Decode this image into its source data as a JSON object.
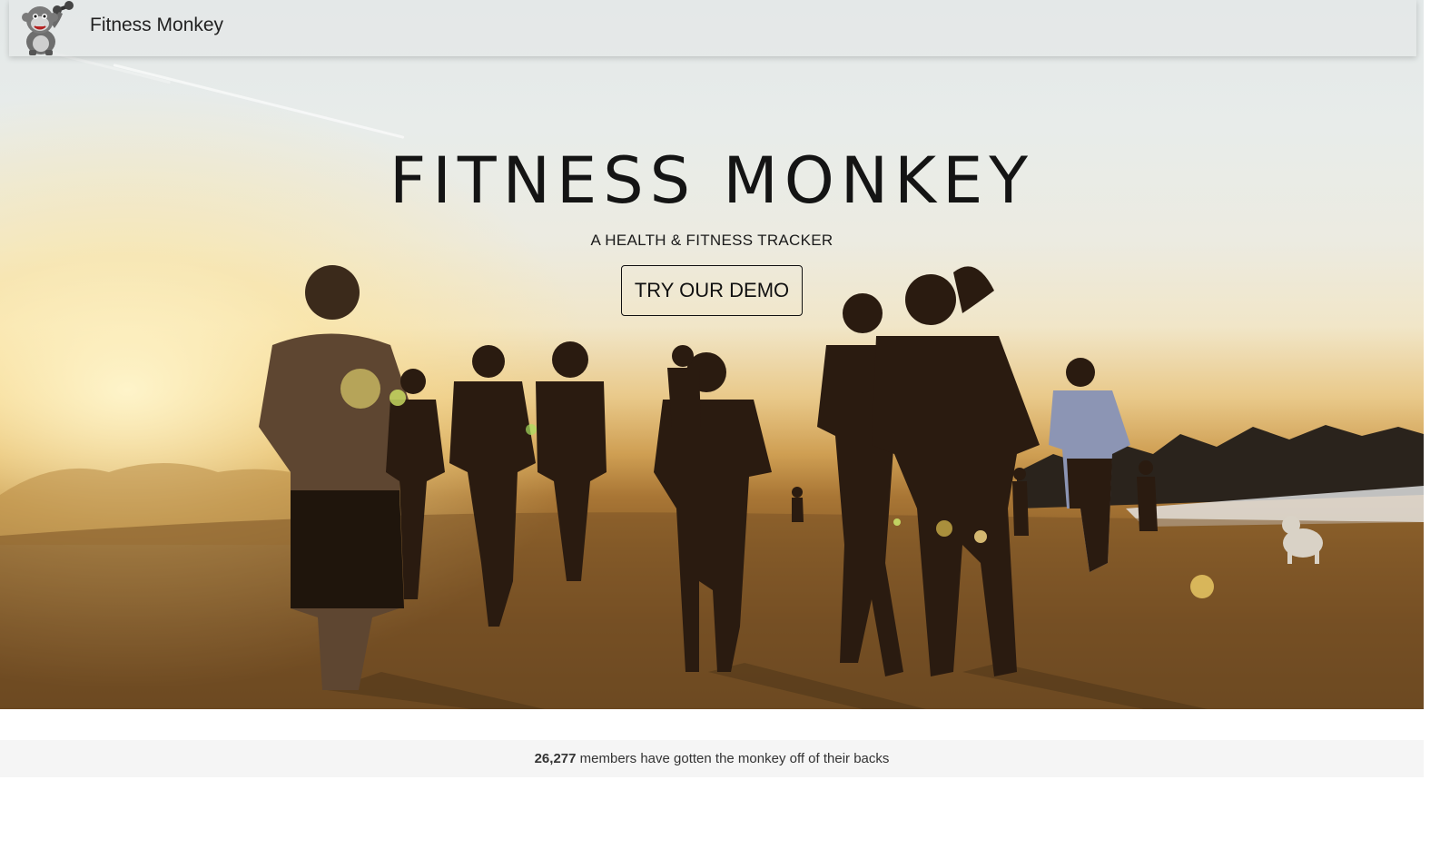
{
  "navbar": {
    "brand_name": "Fitness Monkey",
    "logo_icon": "monkey-lifting-dumbbell-logo"
  },
  "hero": {
    "title": "FITNESS MONKEY",
    "subtitle": "A HEALTH & FITNESS TRACKER",
    "cta_label": "TRY OUR DEMO",
    "background": "runners-on-beach-at-sunset-photo"
  },
  "stats": {
    "member_count": "26,277",
    "member_text": " members have gotten the monkey off of their backs"
  },
  "colors": {
    "stats_bg": "#f5f5f5",
    "text_dark": "#141414"
  }
}
